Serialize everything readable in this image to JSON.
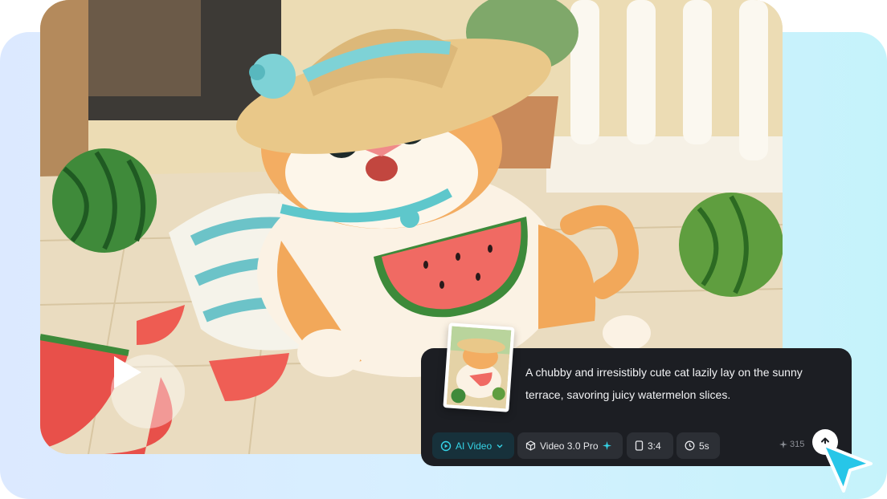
{
  "prompt": {
    "text": "A chubby and irresistibly cute cat lazily lay on the sunny terrace, savoring juicy watermelon slices."
  },
  "toolbar": {
    "mode_label": "AI Video",
    "model_label": "Video 3.0 Pro",
    "ratio_label": "3:4",
    "duration_label": "5s",
    "credits": "315"
  },
  "colors": {
    "accent": "#35d3e6",
    "card_bg": "#1c1e23",
    "chip_bg": "#2c2f35"
  },
  "icons": {
    "play": "play-icon",
    "mode": "video-play-icon",
    "model": "cube-icon",
    "ratio": "aspect-ratio-icon",
    "duration": "clock-icon",
    "send": "arrow-up-icon",
    "cursor": "cursor-icon"
  }
}
